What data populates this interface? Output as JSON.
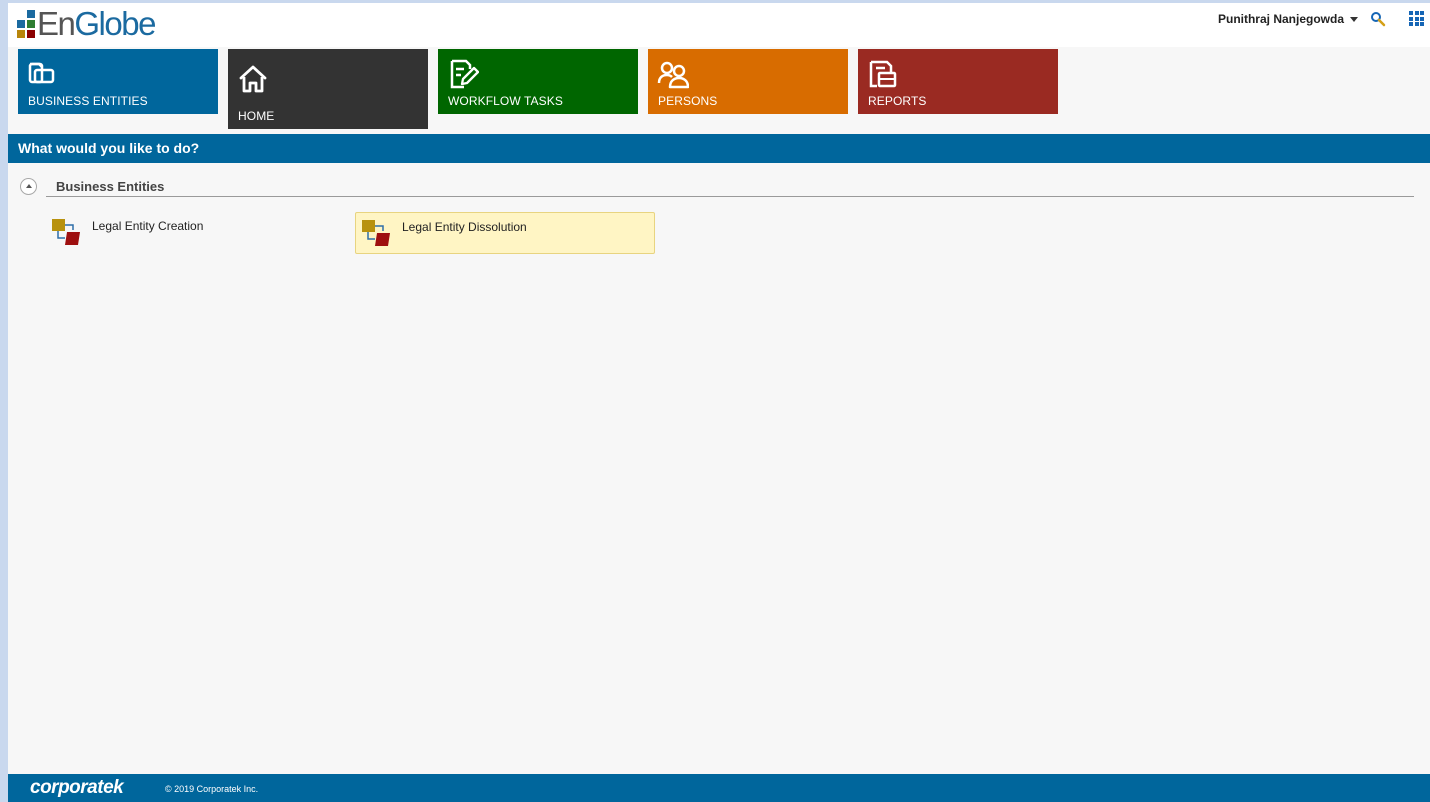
{
  "header": {
    "logo_prefix": "En",
    "logo_suffix": "Globe",
    "logo_colors": [
      "#1b6aa0",
      "#2e7d32",
      "#b8860b",
      "#8b0000"
    ],
    "user_name": "Punithraj Nanjegowda",
    "search_icon": "search-icon",
    "apps_icon": "apps-grid-icon"
  },
  "tiles": [
    {
      "label": "BUSINESS ENTITIES",
      "color": "#00669c",
      "icon": "folder-icon",
      "active": false
    },
    {
      "label": "HOME",
      "color": "#333333",
      "icon": "home-icon",
      "active": true
    },
    {
      "label": "WORKFLOW TASKS",
      "color": "#006600",
      "icon": "edit-document-icon",
      "active": false
    },
    {
      "label": "PERSONS",
      "color": "#d86c00",
      "icon": "persons-icon",
      "active": false
    },
    {
      "label": "REPORTS",
      "color": "#9a2a22",
      "icon": "reports-icon",
      "active": false
    }
  ],
  "banner": {
    "title": "What would you like to do?"
  },
  "section": {
    "title": "Business Entities",
    "items": [
      {
        "label": "Legal Entity Creation",
        "icon": "entity-icon",
        "highlighted": false
      },
      {
        "label": "Legal Entity Dissolution",
        "icon": "entity-icon",
        "highlighted": true
      }
    ]
  },
  "footer": {
    "brand": "corporatek",
    "copyright": "© 2019 Corporatek Inc."
  }
}
